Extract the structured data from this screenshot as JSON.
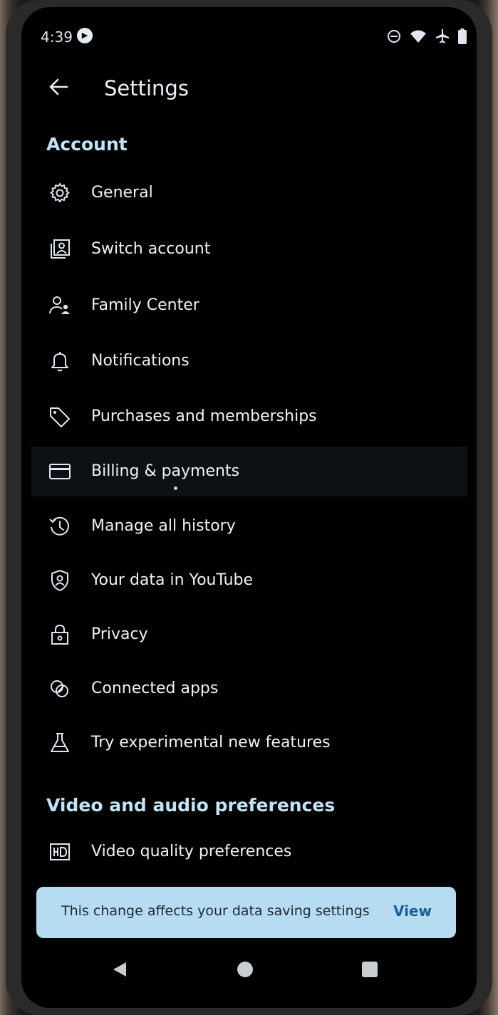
{
  "status_bar": {
    "time": "4:39"
  },
  "header": {
    "title": "Settings"
  },
  "sections": [
    {
      "title": "Account",
      "items": [
        {
          "label": "General",
          "icon": "gear-icon"
        },
        {
          "label": "Switch account",
          "icon": "switch-account-icon"
        },
        {
          "label": "Family Center",
          "icon": "family-icon"
        },
        {
          "label": "Notifications",
          "icon": "bell-icon"
        },
        {
          "label": "Purchases and memberships",
          "icon": "tag-icon"
        },
        {
          "label": "Billing & payments",
          "icon": "credit-card-icon"
        },
        {
          "label": "Manage all history",
          "icon": "history-icon"
        },
        {
          "label": "Your data in YouTube",
          "icon": "shield-user-icon"
        },
        {
          "label": "Privacy",
          "icon": "lock-icon"
        },
        {
          "label": "Connected apps",
          "icon": "connected-apps-icon"
        },
        {
          "label": "Try experimental new features",
          "icon": "flask-icon"
        }
      ]
    },
    {
      "title": "Video and audio preferences",
      "items": [
        {
          "label": "Video quality preferences",
          "icon": "hd-icon"
        }
      ]
    }
  ],
  "snackbar": {
    "message": "This change affects your data saving settings",
    "action": "View"
  },
  "colors": {
    "background": "#000000",
    "section_header": "#bfe3f7",
    "snackbar_bg": "#b6dcf1",
    "snackbar_action": "#1d5f94"
  }
}
